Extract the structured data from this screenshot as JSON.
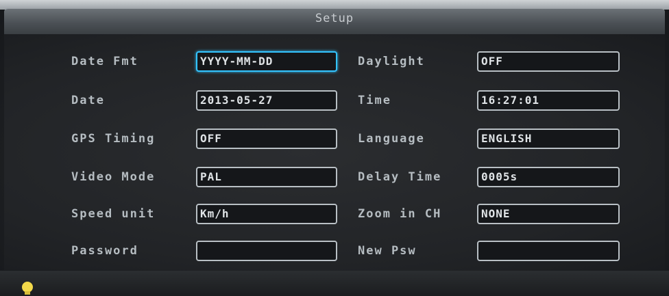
{
  "title": "Setup",
  "rows": [
    {
      "left": {
        "label": "Date Fmt",
        "value": "YYYY-MM-DD",
        "focused": true
      },
      "right": {
        "label": "Daylight",
        "value": "OFF"
      }
    },
    {
      "left": {
        "label": "Date",
        "value": "2013-05-27"
      },
      "right": {
        "label": "Time",
        "value": "16:27:01"
      }
    },
    {
      "left": {
        "label": "GPS Timing",
        "value": "OFF"
      },
      "right": {
        "label": "Language",
        "value": "ENGLISH"
      }
    },
    {
      "left": {
        "label": "Video Mode",
        "value": "PAL"
      },
      "right": {
        "label": "Delay Time",
        "value": "0005s"
      }
    },
    {
      "left": {
        "label": "Speed unit",
        "value": "Km/h"
      },
      "right": {
        "label": "Zoom in CH",
        "value": "NONE"
      }
    },
    {
      "left": {
        "label": "Password",
        "value": ""
      },
      "right": {
        "label": "New Psw",
        "value": ""
      }
    }
  ],
  "colors": {
    "focus_border": "#33c4ff",
    "field_border": "#b9c0c5",
    "label_text": "#b6bdc2",
    "bulb": "#f2d84a"
  },
  "icons": {
    "status": "lightbulb-icon"
  }
}
